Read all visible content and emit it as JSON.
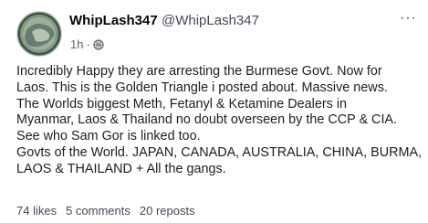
{
  "post": {
    "author_name": "WhipLash347",
    "author_handle": "@WhipLash347",
    "time": "1h",
    "separator": "·",
    "more_icon": "ellipsis-icon",
    "audience_icon": "globe-icon",
    "lines": [
      "Incredibly Happy they are arresting the Burmese Govt. Now for",
      "Laos. This is the Golden Triangle i posted about. Massive news.",
      "The Worlds biggest Meth, Fetanyl & Ketamine Dealers in",
      "Myanmar, Laos & Thailand no doubt overseen by the CCP & CIA.",
      "See who Sam Gor is linked too.",
      "Govts of the World. JAPAN, CANADA, AUSTRALIA, CHINA, BURMA,",
      "LAOS & THAILAND + All the gangs."
    ],
    "stats": {
      "likes": "74 likes",
      "comments": "5 comments",
      "reposts": "20 reposts"
    }
  }
}
